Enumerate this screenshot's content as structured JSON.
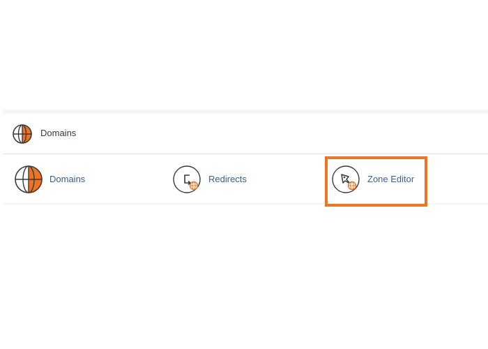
{
  "section": {
    "title": "Domains",
    "icon": "globe-icon"
  },
  "tools": [
    {
      "label": "Domains",
      "icon": "globe-icon"
    },
    {
      "label": "Redirects",
      "icon": "redirect-globe-icon"
    },
    {
      "label": "Zone Editor",
      "icon": "zone-editor-rocket-icon"
    }
  ],
  "colors": {
    "accent": "#f07320",
    "link": "#3f5d8c",
    "icon_outline": "#3a3a3a",
    "highlight": "#f07320"
  }
}
